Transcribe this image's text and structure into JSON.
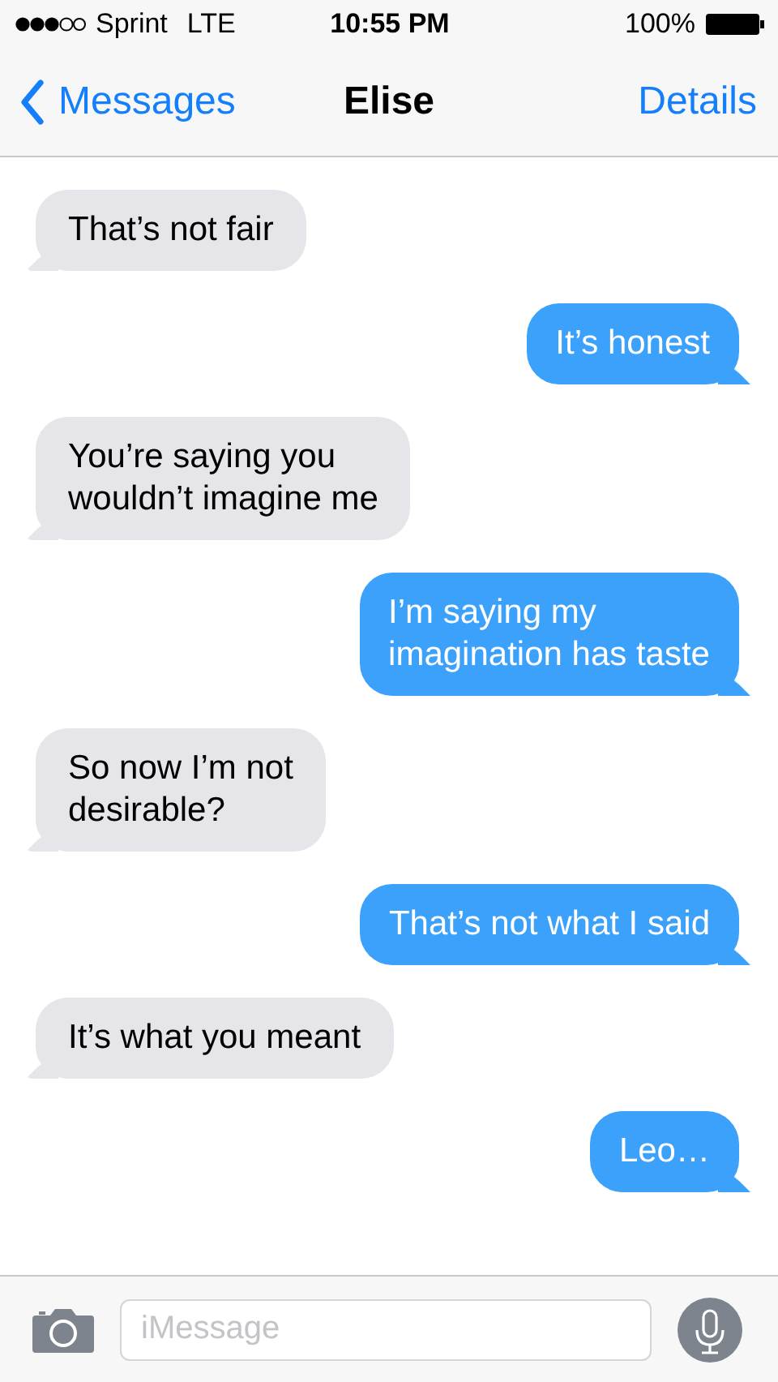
{
  "status_bar": {
    "carrier": "Sprint",
    "network": "LTE",
    "time": "10:55 PM",
    "battery": "100%"
  },
  "nav_bar": {
    "back": "Messages",
    "title": "Elise",
    "action": "Details"
  },
  "messages": [
    {
      "kind": "incoming",
      "text": "That’s not fair"
    },
    {
      "kind": "outgoing",
      "text": "It’s honest"
    },
    {
      "kind": "incoming",
      "text": "You’re saying you\nwouldn’t imagine me"
    },
    {
      "kind": "outgoing",
      "text": "I’m saying my\nimagination has taste"
    },
    {
      "kind": "incoming",
      "text": "So now I’m not\ndesirable?"
    },
    {
      "kind": "outgoing",
      "text": "That’s not what I said"
    },
    {
      "kind": "incoming",
      "text": "It’s what you meant"
    },
    {
      "kind": "outgoing",
      "text": "Leo…"
    }
  ],
  "input_bar": {
    "placeholder": "iMessage"
  }
}
